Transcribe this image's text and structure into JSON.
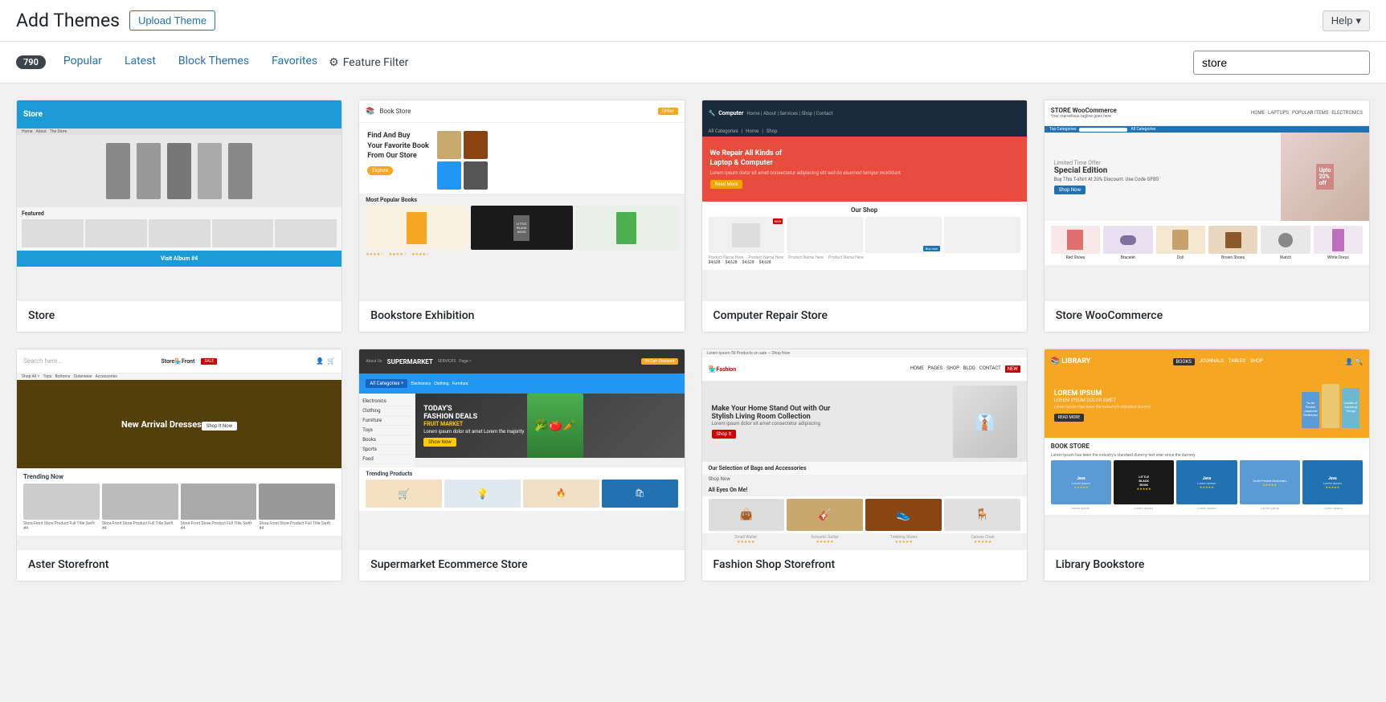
{
  "header": {
    "title": "Add Themes",
    "upload_button": "Upload Theme",
    "help_button": "Help"
  },
  "nav": {
    "count": "790",
    "tabs": [
      {
        "id": "popular",
        "label": "Popular",
        "active": false
      },
      {
        "id": "latest",
        "label": "Latest",
        "active": false
      },
      {
        "id": "block-themes",
        "label": "Block Themes",
        "active": false
      },
      {
        "id": "favorites",
        "label": "Favorites",
        "active": false
      }
    ],
    "feature_filter": "Feature Filter",
    "search_placeholder": "store",
    "search_value": "store"
  },
  "themes": [
    {
      "id": "store",
      "name": "Store",
      "preview_type": "store"
    },
    {
      "id": "bookstore-exhibition",
      "name": "Bookstore Exhibition",
      "preview_type": "bookstore"
    },
    {
      "id": "computer-repair-store",
      "name": "Computer Repair Store",
      "preview_type": "computer"
    },
    {
      "id": "store-woocommerce",
      "name": "Store WooCommerce",
      "preview_type": "woocommerce"
    },
    {
      "id": "aster-storefront",
      "name": "Aster Storefront",
      "preview_type": "storefront"
    },
    {
      "id": "supermarket-ecommerce-store",
      "name": "Supermarket Ecommerce Store",
      "preview_type": "supermarket"
    },
    {
      "id": "fashion-shop-storefront",
      "name": "Fashion Shop Storefront",
      "preview_type": "fashion"
    },
    {
      "id": "library-bookstore",
      "name": "Library Bookstore",
      "preview_type": "library"
    }
  ]
}
